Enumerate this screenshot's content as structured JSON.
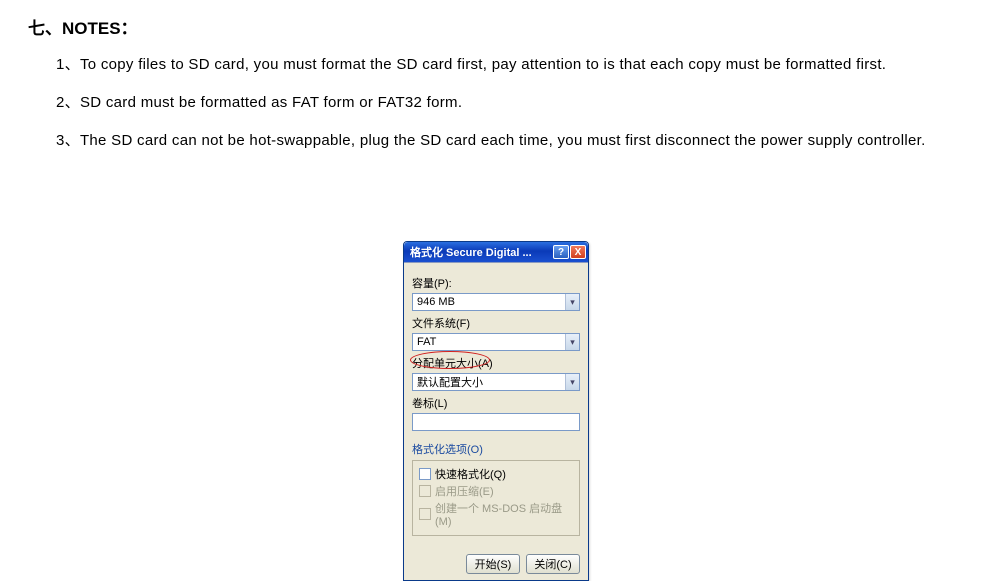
{
  "doc": {
    "section_title": "七、NOTES：",
    "note1": "1、To copy files to SD card, you must format the SD card first, pay attention to is that each copy must be formatted first.",
    "note2": "2、SD card must be formatted as FAT form or FAT32 form.",
    "note3": "3、The SD card can not be hot-swappable, plug the SD card each time, you must first disconnect the power supply controller."
  },
  "dialog": {
    "title": "格式化 Secure Digital ...",
    "help": "?",
    "close": "X",
    "capacity_label": "容量(P):",
    "capacity_value": "946 MB",
    "filesystem_label": "文件系统(F)",
    "filesystem_value": "FAT",
    "allocation_label": "分配单元大小(A)",
    "allocation_value": "默认配置大小",
    "volume_label": "卷标(L)",
    "volume_value": "",
    "options_title": "格式化选项(O)",
    "quick_format": "快速格式化(Q)",
    "enable_compression": "启用压缩(E)",
    "create_msdos": "创建一个 MS-DOS 启动盘(M)",
    "start_btn": "开始(S)",
    "close_btn": "关闭(C)"
  }
}
